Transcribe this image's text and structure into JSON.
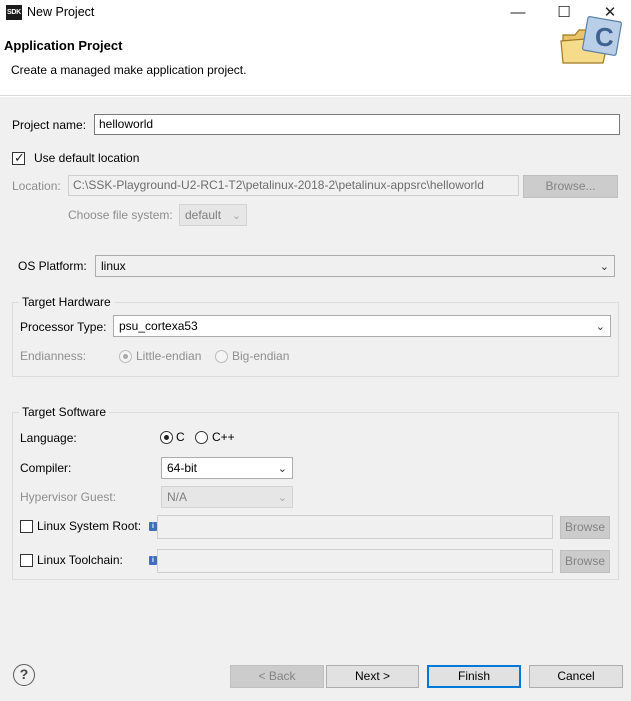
{
  "window": {
    "app_icon_text": "SDK",
    "title": "New Project",
    "controls": {
      "minimize": "—",
      "maximize": "☐",
      "close": "✕"
    }
  },
  "header": {
    "title": "Application Project",
    "description": "Create a managed make application project.",
    "icon": "folder-wizard-icon"
  },
  "project": {
    "name_label": "Project name:",
    "name_value": "helloworld",
    "use_default_label": "Use default location",
    "use_default_checked": true,
    "location_label": "Location:",
    "location_value": "C:\\SSK-Playground-U2-RC1-T2\\petalinux-2018-2\\petalinux-appsrc\\helloworld",
    "browse_label": "Browse...",
    "filesystem_label": "Choose file system:",
    "filesystem_value": "default"
  },
  "os": {
    "label": "OS Platform:",
    "value": "linux"
  },
  "hardware": {
    "title": "Target Hardware",
    "processor_label": "Processor Type:",
    "processor_value": "psu_cortexa53",
    "endian_label": "Endianness:",
    "little_label": "Little-endian",
    "big_label": "Big-endian",
    "selected": "Little-endian"
  },
  "software": {
    "title": "Target Software",
    "language_label": "Language:",
    "lang_c": "C",
    "lang_cpp": "C++",
    "language_selected": "C",
    "compiler_label": "Compiler:",
    "compiler_value": "64-bit",
    "hypervisor_label": "Hypervisor Guest:",
    "hypervisor_value": "N/A",
    "sysroot_label": "Linux System Root:",
    "sysroot_value": "",
    "toolchain_label": "Linux Toolchain:",
    "toolchain_value": "",
    "browse_label": "Browse",
    "info_glyph": "i"
  },
  "footer": {
    "help_glyph": "?",
    "back_label": "< Back",
    "next_label": "Next >",
    "finish_label": "Finish",
    "cancel_label": "Cancel"
  }
}
